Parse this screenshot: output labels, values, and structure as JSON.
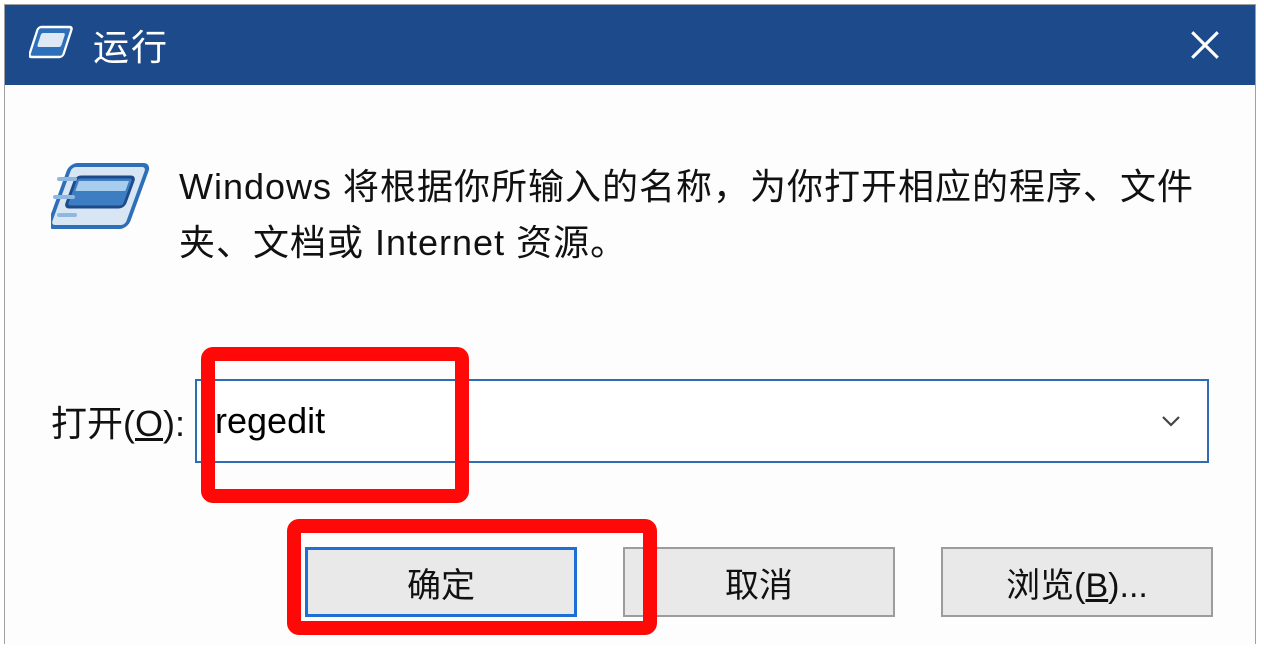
{
  "titlebar": {
    "title": "运行"
  },
  "description": "Windows 将根据你所输入的名称，为你打开相应的程序、文件夹、文档或 Internet 资源。",
  "open": {
    "label_pre": "打开(",
    "label_key": "O",
    "label_post": "):",
    "value": "regedit"
  },
  "buttons": {
    "ok": "确定",
    "cancel": "取消",
    "browse_pre": "浏览(",
    "browse_key": "B",
    "browse_post": ")..."
  }
}
